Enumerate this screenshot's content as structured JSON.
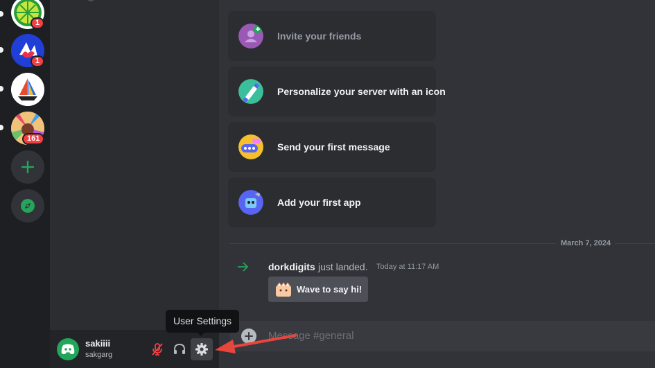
{
  "servers": [
    {
      "name": "server-lime",
      "badge": "1"
    },
    {
      "name": "server-blue",
      "badge": "1"
    },
    {
      "name": "server-boat",
      "badge": ""
    },
    {
      "name": "server-art",
      "badge": "161"
    }
  ],
  "rail": {
    "add_server_icon": "plus-icon",
    "explore_icon": "compass-icon"
  },
  "user": {
    "name": "sakiiii",
    "tag": "sakgarg"
  },
  "tooltip": {
    "text": "User Settings"
  },
  "cards": [
    {
      "label": "Invite your friends"
    },
    {
      "label": "Personalize your server with an icon"
    },
    {
      "label": "Send your first message"
    },
    {
      "label": "Add your first app"
    }
  ],
  "divider": {
    "date": "March 7, 2024"
  },
  "join": {
    "user": "dorkdigits",
    "text": "just landed.",
    "time": "Today at 11:17 AM"
  },
  "wave": {
    "label": "Wave to say hi!"
  },
  "composer": {
    "placeholder": "Message #general"
  },
  "colors": {
    "accent_green": "#23a55a",
    "annotation_red": "#e8453c",
    "mute_red": "#f23f43"
  }
}
